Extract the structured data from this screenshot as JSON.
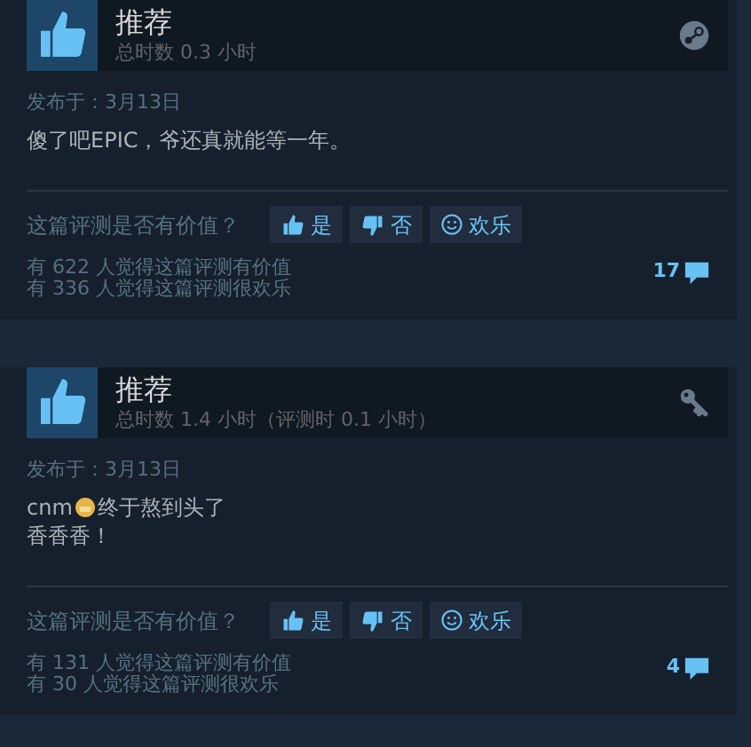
{
  "reviews": [
    {
      "verdict": "推荐",
      "playtime": "总时数 0.3 小时",
      "source_icon": {
        "kind": "steam"
      },
      "posted": "发布于：3月13日",
      "body": [
        [
          {
            "kind": "text",
            "text": "傻了吧EPIC，爷还真就能等一年。"
          }
        ]
      ],
      "question": "这篇评测是否有价值？",
      "buttons": [
        {
          "kind": "up",
          "label": "是"
        },
        {
          "kind": "down",
          "label": "否"
        },
        {
          "kind": "smile",
          "label": "欢乐"
        }
      ],
      "helpful": "有 622 人觉得这篇评测有价值",
      "funny": "有 336 人觉得这篇评测很欢乐",
      "comments": "17"
    },
    {
      "verdict": "推荐",
      "playtime": "总时数 1.4 小时（评测时 0.1 小时）",
      "source_icon": {
        "kind": "key"
      },
      "posted": "发布于：3月13日",
      "body": [
        [
          {
            "kind": "text",
            "text": "cnm"
          },
          {
            "kind": "emoji"
          },
          {
            "kind": "text",
            "text": "终于熬到头了"
          }
        ],
        [
          {
            "kind": "text",
            "text": "香香香！"
          }
        ]
      ],
      "question": "这篇评测是否有价值？",
      "buttons": [
        {
          "kind": "up",
          "label": "是"
        },
        {
          "kind": "down",
          "label": "否"
        },
        {
          "kind": "smile",
          "label": "欢乐"
        }
      ],
      "helpful": "有 131 人觉得这篇评测有价值",
      "funny": "有 30 人觉得这篇评测很欢乐",
      "comments": "4"
    }
  ]
}
